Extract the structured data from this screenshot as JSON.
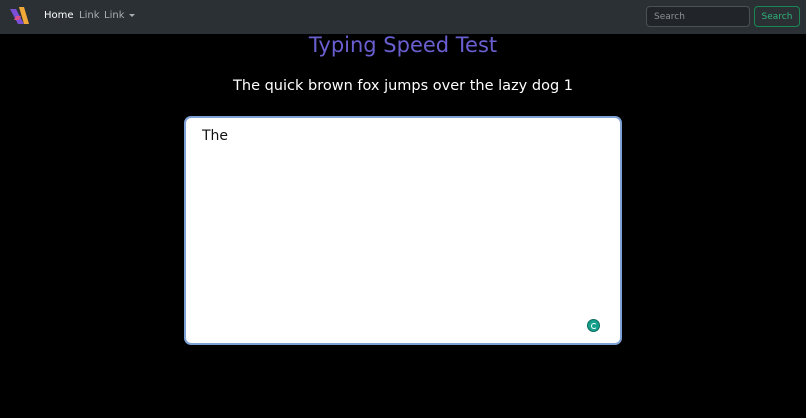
{
  "navbar": {
    "links": [
      {
        "label": "Home"
      },
      {
        "label": "Link"
      },
      {
        "label": "Link"
      }
    ],
    "search": {
      "placeholder": "Search",
      "button_label": "Search"
    }
  },
  "main": {
    "title": "Typing Speed Test",
    "prompt_text": "The quick brown fox jumps over the lazy dog 1",
    "typed_text": "The"
  },
  "colors": {
    "navbar_bg": "#2b3035",
    "page_bg": "#000000",
    "title": "#6a5fd0",
    "success_outline": "#198754",
    "textarea_border": "#7ea1d6"
  },
  "icons": {
    "logo": "brand-logo-icon",
    "dropdown": "caret-down-icon",
    "grammar": "grammar-assistant-icon"
  }
}
